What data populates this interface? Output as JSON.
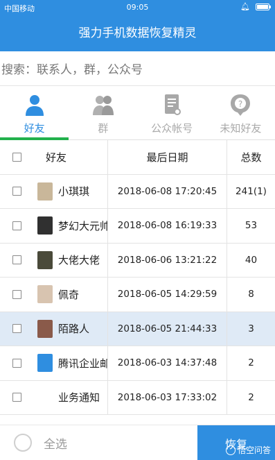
{
  "status_bar": {
    "carrier": "中国移动",
    "time": "09:05"
  },
  "app": {
    "title": "强力手机数据恢复精灵"
  },
  "search": {
    "placeholder": "搜索：联系人，群，公众号"
  },
  "tabs": [
    {
      "label": "好友",
      "icon": "person-icon",
      "active": true
    },
    {
      "label": "群",
      "icon": "group-icon",
      "active": false
    },
    {
      "label": "公众帐号",
      "icon": "official-account-icon",
      "active": false
    },
    {
      "label": "未知好友",
      "icon": "unknown-friend-icon",
      "active": false
    }
  ],
  "table": {
    "headers": {
      "name": "好友",
      "date": "最后日期",
      "count": "总数"
    },
    "rows": [
      {
        "name": "小琪琪",
        "date": "2018-06-08 17:20:45",
        "count": "241(1)",
        "avatar_color": "#c9b79a"
      },
      {
        "name": "梦幻大元帅",
        "date": "2018-06-08 16:19:33",
        "count": "53",
        "avatar_color": "#303030"
      },
      {
        "name": "大佬大佬",
        "date": "2018-06-06 13:21:22",
        "count": "40",
        "avatar_color": "#4a4a3a"
      },
      {
        "name": "佩奇",
        "date": "2018-06-05 14:29:59",
        "count": "8",
        "avatar_color": "#d8c4b0"
      },
      {
        "name": "陌路人",
        "date": "2018-06-05 21:44:33",
        "count": "3",
        "avatar_color": "#8a5a4a"
      },
      {
        "name": "腾讯企业邮",
        "date": "2018-06-03 14:37:48",
        "count": "2",
        "avatar_color": "#2f8ee0"
      },
      {
        "name": "业务通知",
        "date": "2018-06-03 17:33:02",
        "count": "2",
        "avatar_color": ""
      }
    ],
    "selected_row_index": 4
  },
  "bottom": {
    "select_all": "全选",
    "restore": "恢复",
    "watermark": "悟空问答"
  },
  "colors": {
    "primary": "#2f8ee0",
    "tab_indicator": "#22b14c",
    "selected_row": "#dfeaf6"
  }
}
